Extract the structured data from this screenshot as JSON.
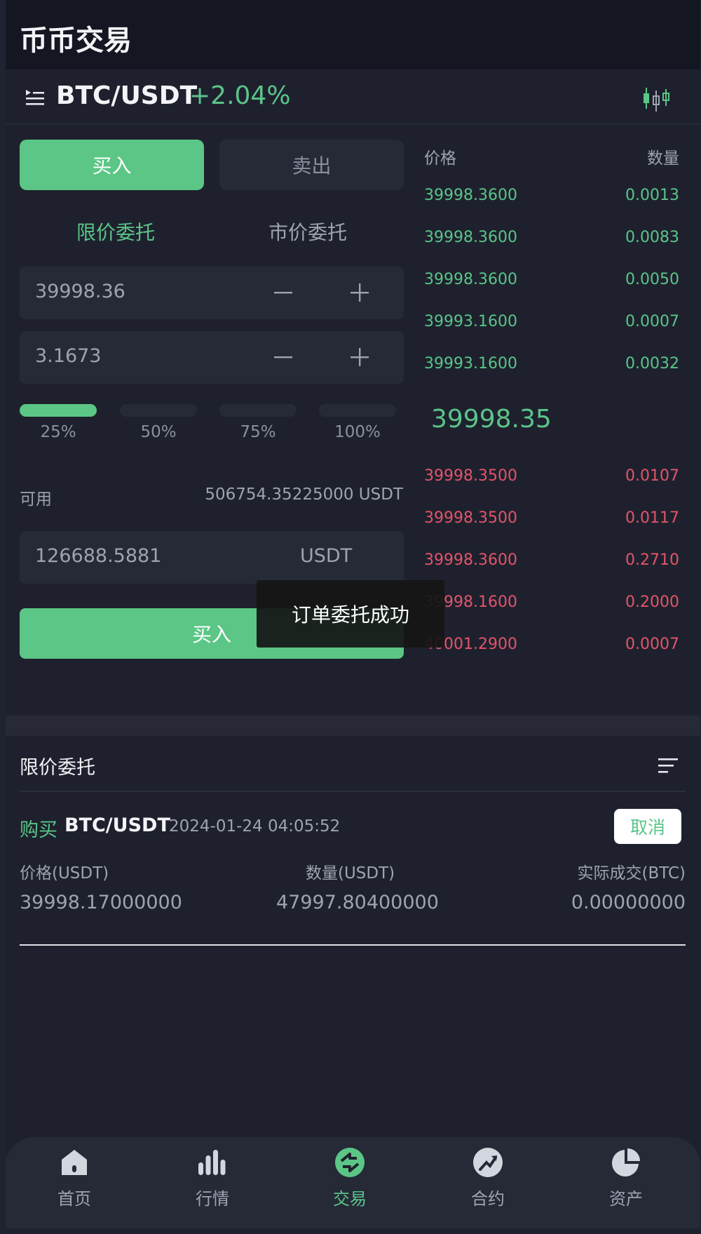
{
  "header": {
    "title": "币币交易"
  },
  "pair": {
    "name": "BTC/USDT",
    "change": "+2.04%"
  },
  "trade": {
    "buy_tab": "买入",
    "sell_tab": "卖出",
    "limit_tab": "限价委托",
    "market_tab": "市价委托",
    "price_value": "39998.36",
    "amount_value": "3.1673",
    "percents": [
      "25%",
      "50%",
      "75%",
      "100%"
    ],
    "selected_percent": 0.25,
    "available_label": "可用",
    "available_value": "506754.35225000 USDT",
    "total_value": "126688.5881",
    "total_unit": "USDT",
    "submit_label": "买入"
  },
  "toast": "订单委托成功",
  "orderbook": {
    "price_header": "价格",
    "qty_header": "数量",
    "asks": [
      {
        "price": "39998.3600",
        "qty": "0.0013"
      },
      {
        "price": "39998.3600",
        "qty": "0.0083"
      },
      {
        "price": "39998.3600",
        "qty": "0.0050"
      },
      {
        "price": "39993.1600",
        "qty": "0.0007"
      },
      {
        "price": "39993.1600",
        "qty": "0.0032"
      }
    ],
    "last_price": "39998.35",
    "bids": [
      {
        "price": "39998.3500",
        "qty": "0.0107"
      },
      {
        "price": "39998.3500",
        "qty": "0.0117"
      },
      {
        "price": "39998.3600",
        "qty": "0.2710"
      },
      {
        "price": "39998.1600",
        "qty": "0.2000"
      },
      {
        "price": "40001.2900",
        "qty": "0.0007"
      }
    ]
  },
  "orders": {
    "title": "限价委托",
    "items": [
      {
        "side": "购买",
        "pair": "BTC/USDT",
        "time": "2024-01-24 04:05:52",
        "cancel_label": "取消",
        "price_header": "价格(USDT)",
        "qty_header": "数量(USDT)",
        "filled_header": "实际成交(BTC)",
        "price": "39998.17000000",
        "qty": "47997.80400000",
        "filled": "0.00000000"
      }
    ]
  },
  "tabbar": {
    "items": [
      {
        "label": "首页",
        "icon": "home-icon"
      },
      {
        "label": "行情",
        "icon": "market-bars-icon"
      },
      {
        "label": "交易",
        "icon": "trade-icon"
      },
      {
        "label": "合约",
        "icon": "contract-trend-icon"
      },
      {
        "label": "资产",
        "icon": "assets-pie-icon"
      }
    ],
    "active": "交易"
  },
  "colors": {
    "accent_green": "#5bc685",
    "ask_red": "#e2546b",
    "background": "#1e212d"
  }
}
